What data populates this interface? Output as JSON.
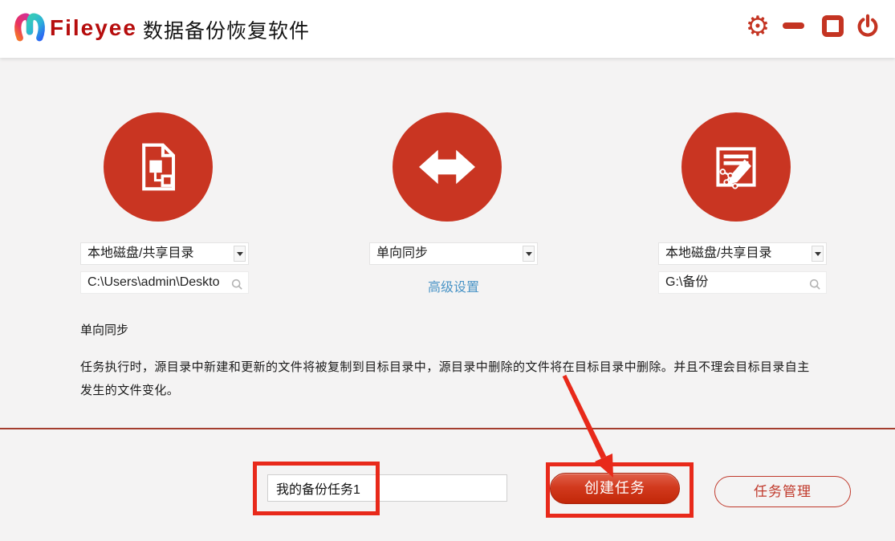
{
  "window": {
    "brand": "Fileyee",
    "title": "数据备份恢复软件"
  },
  "header_icons": {
    "settings_glyph": "⚙"
  },
  "columns": {
    "source": {
      "type": "本地磁盘/共享目录",
      "path": "C:\\Users\\admin\\Deskto"
    },
    "mode": {
      "type": "单向同步",
      "advanced": "高级设置"
    },
    "target": {
      "type": "本地磁盘/共享目录",
      "path": "G:\\备份"
    }
  },
  "info": {
    "heading": "单向同步",
    "body": "任务执行时，源目录中新建和更新的文件将被复制到目标目录中，源目录中删除的文件将在目标目录中删除。并且不理会目标目录自主发生的文件变化。"
  },
  "footer": {
    "task_name": "我的备份任务1",
    "create": "创建任务",
    "manage": "任务管理"
  },
  "colors": {
    "accent_red": "#c93522",
    "annotation_red": "#e8291a",
    "link_blue": "#4a94c6",
    "divider_red": "#a43e2e"
  }
}
